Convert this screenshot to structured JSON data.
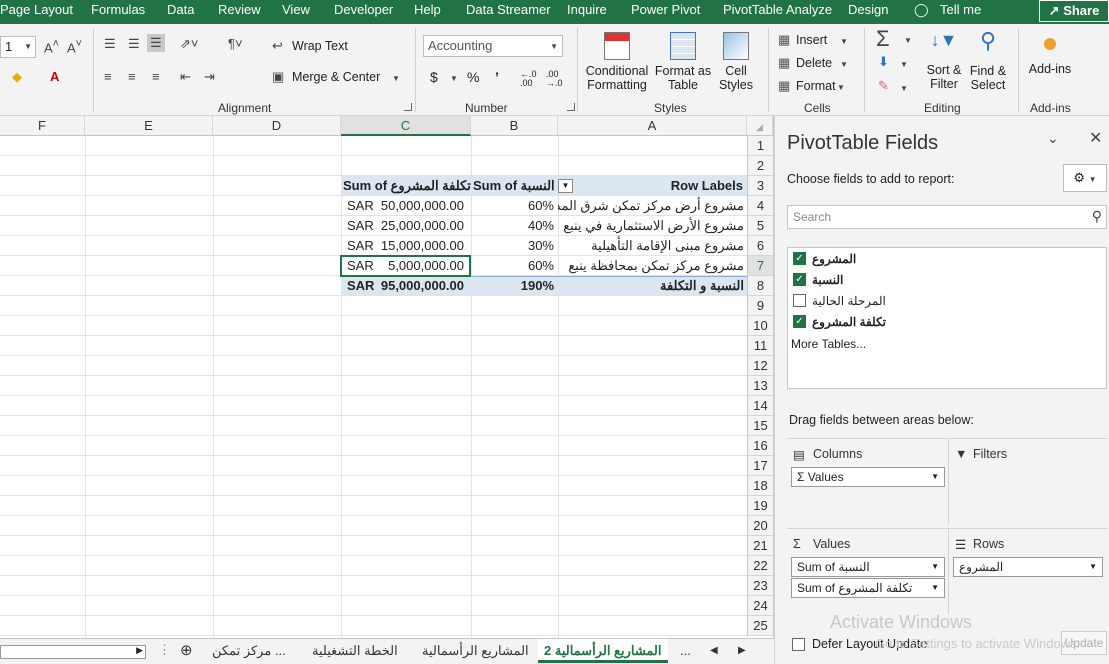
{
  "menu_tabs": [
    {
      "label": "Page Layout"
    },
    {
      "label": "Formulas"
    },
    {
      "label": "Data"
    },
    {
      "label": "Review"
    },
    {
      "label": "View"
    },
    {
      "label": "Developer"
    },
    {
      "label": "Help"
    },
    {
      "label": "Data Streamer"
    },
    {
      "label": "Inquire"
    },
    {
      "label": "Power Pivot"
    },
    {
      "label": "PivotTable Analyze"
    },
    {
      "label": "Design"
    },
    {
      "label": "Tell me"
    }
  ],
  "share_label": "Share",
  "ribbon": {
    "font_size_value": "1",
    "wrap_text": "Wrap Text",
    "merge_center": "Merge & Center",
    "alignment_label": "Alignment",
    "number_format": "Accounting",
    "currency": "$",
    "percent": "%",
    "comma": "’",
    "dec_inc": "←.0 .00",
    "dec_dec": ".00 →.0",
    "number_label": "Number",
    "cond_format_1": "Conditional",
    "cond_format_2": "Formatting",
    "format_table_1": "Format as",
    "format_table_2": "Table",
    "cell_styles_1": "Cell",
    "cell_styles_2": "Styles",
    "styles_label": "Styles",
    "insert": "Insert",
    "delete": "Delete",
    "format": "Format",
    "cells_label": "Cells",
    "sort_filter_1": "Sort &",
    "sort_filter_2": "Filter",
    "find_select_1": "Find &",
    "find_select_2": "Select",
    "editing_label": "Editing",
    "addins": "Add-ins",
    "addins_label": "Add-ins"
  },
  "columns": {
    "F": "F",
    "E": "E",
    "D": "D",
    "C": "C",
    "B": "B",
    "A": "A"
  },
  "rows": [
    "1",
    "2",
    "3",
    "4",
    "5",
    "6",
    "7",
    "8",
    "9",
    "10",
    "11",
    "12",
    "13",
    "14",
    "15",
    "16",
    "17",
    "18",
    "19",
    "20",
    "21",
    "22",
    "23",
    "24",
    "25"
  ],
  "pivot": {
    "header_c": "Sum of تكلفة المشروع",
    "header_b": "Sum of النسبة",
    "header_a": "Row Labels",
    "rows": [
      {
        "label": "مشروع أرض مركز تمكن شرق المدينة",
        "pct": "60%",
        "currency": "SAR",
        "amount": "50,000,000.00"
      },
      {
        "label": "مشروع الأرض الاستثمارية في ينبع",
        "pct": "40%",
        "currency": "SAR",
        "amount": "25,000,000.00"
      },
      {
        "label": "مشروع مبنى الإقامة التأهيلية",
        "pct": "30%",
        "currency": "SAR",
        "amount": "15,000,000.00"
      },
      {
        "label": "مشروع مركز تمكن بمحافظة ينبع",
        "pct": "60%",
        "currency": "SAR",
        "amount": "5,000,000.00"
      }
    ],
    "total_label": "النسبة و التكلفة",
    "total_pct": "190%",
    "total_currency": "SAR",
    "total_amount": "95,000,000.00"
  },
  "sheet_tabs": {
    "t1": "مركز تمكن  ...",
    "t2": "الخطة التشغيلية",
    "t3": "المشاريع الرأسمالية",
    "t4": "المشاريع الرأسمالية 2",
    "more": "..."
  },
  "pane": {
    "title": "PivotTable Fields",
    "choose": "Choose fields to add to report:",
    "search_placeholder": "Search",
    "fields": [
      {
        "label": "المشروع",
        "checked": true
      },
      {
        "label": "النسبة",
        "checked": true
      },
      {
        "label": "المرحلة الحالية",
        "checked": false
      },
      {
        "label": "تكلفة المشروع",
        "checked": true
      }
    ],
    "more_tables": "More Tables...",
    "drag_label": "Drag fields between areas below:",
    "columns_label": "Columns",
    "filters_label": "Filters",
    "values_pill": "Values",
    "values_label": "Values",
    "rows_label": "Rows",
    "value_pill_1": "Sum of النسبة",
    "value_pill_2": "Sum of تكلفة المشروع",
    "rows_pill": "المشروع",
    "defer": "Defer Layout Update",
    "update": "Update"
  },
  "watermark": {
    "line1": "Activate Windows",
    "line2": "Go to Settings to activate Windows."
  }
}
